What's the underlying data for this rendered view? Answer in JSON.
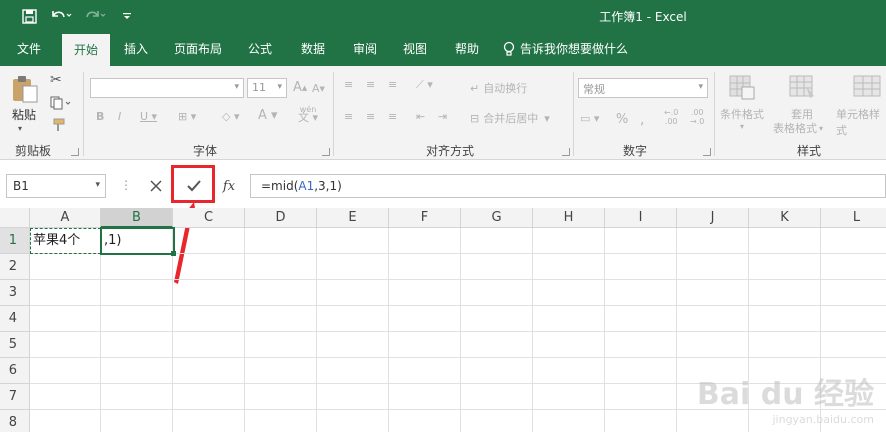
{
  "window": {
    "title": "工作簿1  -  Excel"
  },
  "quick_access": {
    "save_icon": "save-icon",
    "undo_icon": "undo-icon",
    "redo_icon": "redo-icon",
    "customize_icon": "chevron-down-icon"
  },
  "menu": {
    "tabs": [
      {
        "label": "文件",
        "active": false
      },
      {
        "label": "开始",
        "active": true
      },
      {
        "label": "插入",
        "active": false
      },
      {
        "label": "页面布局",
        "active": false
      },
      {
        "label": "公式",
        "active": false
      },
      {
        "label": "数据",
        "active": false
      },
      {
        "label": "审阅",
        "active": false
      },
      {
        "label": "视图",
        "active": false
      },
      {
        "label": "帮助",
        "active": false
      }
    ],
    "tell_me": "告诉我你想要做什么"
  },
  "ribbon": {
    "clipboard": {
      "label": "剪贴板",
      "paste_label": "粘贴"
    },
    "font": {
      "label": "字体",
      "font_size": "11",
      "phonetic": "wén"
    },
    "alignment": {
      "label": "对齐方式",
      "wrap_text": "自动换行",
      "merge_center": "合并后居中"
    },
    "number": {
      "label": "数字",
      "format": "常规"
    },
    "styles": {
      "label": "样式",
      "conditional_format": "条件格式",
      "table_format_1": "套用",
      "table_format_2": "表格格式",
      "cell_styles": "单元格样式"
    }
  },
  "formula_bar": {
    "name_box": "B1",
    "cancel_icon": "close-icon",
    "enter_icon": "checkmark-icon",
    "fx_label": "fx",
    "formula_prefix": "=mid(",
    "formula_ref": "A1",
    "formula_suffix": ",3,1)"
  },
  "sheet": {
    "columns": [
      "A",
      "B",
      "C",
      "D",
      "E",
      "F",
      "G",
      "H",
      "I",
      "J",
      "K",
      "L"
    ],
    "rows": [
      "1",
      "2",
      "3",
      "4",
      "5",
      "6",
      "7",
      "8"
    ],
    "cells": {
      "A1": "苹果4个",
      "B1": ",1)"
    },
    "active_cell": "B1"
  },
  "annotation": {
    "highlight_color": "#e8262b"
  },
  "watermark": {
    "brand": "Bai du 经验",
    "url": "jingyan.baidu.com"
  },
  "colors": {
    "excel_green": "#217346",
    "ref_blue": "#3a64c8"
  }
}
